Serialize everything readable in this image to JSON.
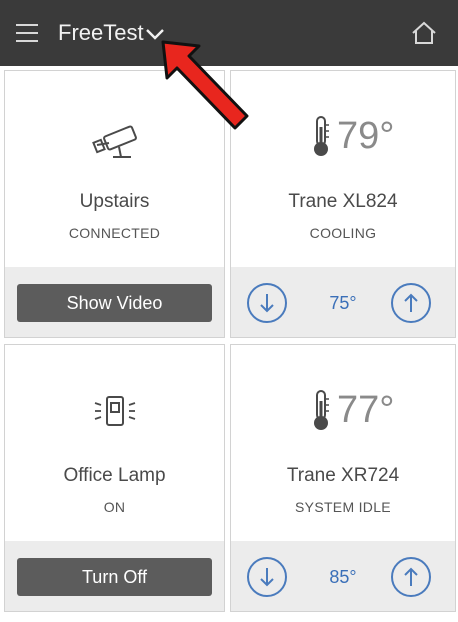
{
  "header": {
    "title": "FreeTest",
    "menu_icon": "hamburger-icon",
    "dropdown_icon": "chevron-down-icon",
    "home_icon": "home-icon",
    "annotation_icon": "red-arrow-pointer"
  },
  "colors": {
    "topbar": "#3a3a3a",
    "button": "#5c5c5c",
    "accent_blue": "#4a7bbd",
    "arrow_red": "#e8261e"
  },
  "cards": {
    "camera": {
      "icon": "camera-icon",
      "name": "Upstairs",
      "status": "CONNECTED",
      "button": "Show Video"
    },
    "thermostat1": {
      "icon": "thermometer-icon",
      "temperature": "79°",
      "name": "Trane XL824",
      "status": "COOLING",
      "setpoint": "75°"
    },
    "lamp": {
      "icon": "light-switch-icon",
      "name": "Office Lamp",
      "status": "ON",
      "button": "Turn Off"
    },
    "thermostat2": {
      "icon": "thermometer-icon",
      "temperature": "77°",
      "name": "Trane XR724",
      "status": "SYSTEM IDLE",
      "setpoint": "85°"
    }
  }
}
